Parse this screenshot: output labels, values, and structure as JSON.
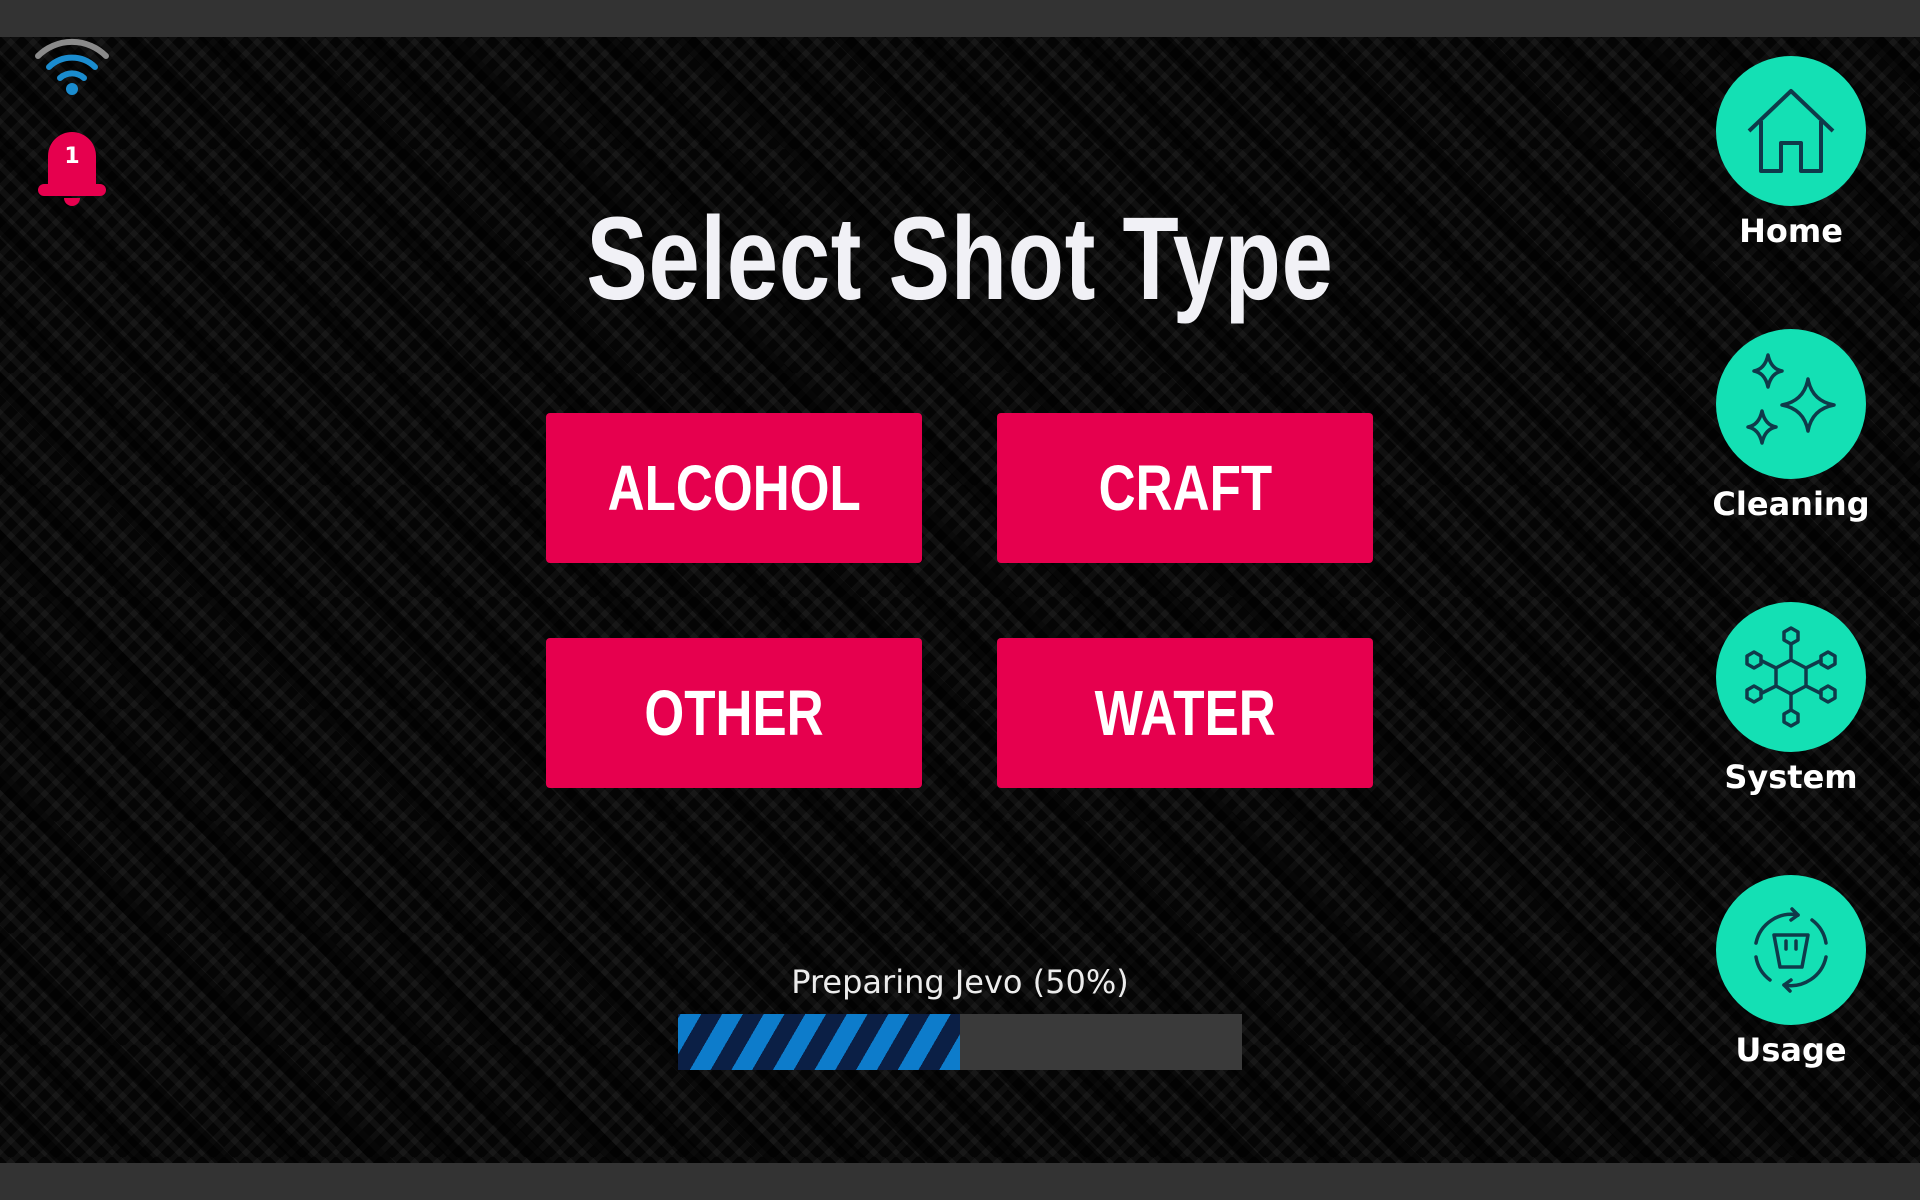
{
  "status": {
    "notification_count": "1",
    "wifi_icon": "wifi-icon",
    "bell_icon": "bell-icon",
    "wifi_color": "#1a8ccf",
    "bell_color": "#e6004e"
  },
  "main": {
    "title": "Select Shot Type",
    "shot_types": [
      {
        "label": "ALCOHOL"
      },
      {
        "label": "CRAFT"
      },
      {
        "label": "OTHER"
      },
      {
        "label": "WATER"
      }
    ],
    "button_color": "#e6004e"
  },
  "progress": {
    "label": "Preparing Jevo (50%)",
    "percent": 50
  },
  "nav": {
    "accent_color": "#14e0b4",
    "items": [
      {
        "label": "Home",
        "icon": "home-icon"
      },
      {
        "label": "Cleaning",
        "icon": "sparkles-icon"
      },
      {
        "label": "System",
        "icon": "network-icon"
      },
      {
        "label": "Usage",
        "icon": "cup-cycle-icon"
      }
    ]
  }
}
